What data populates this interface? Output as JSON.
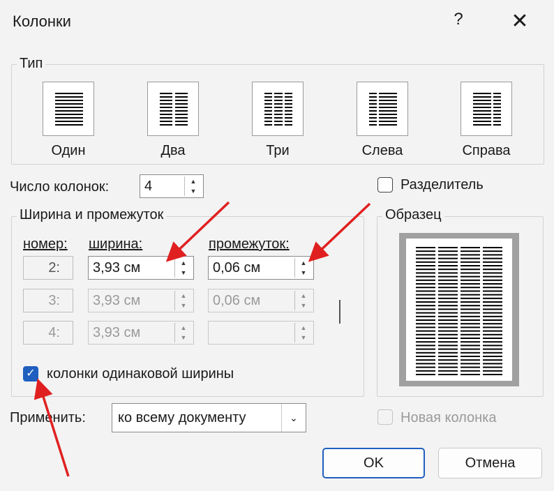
{
  "window": {
    "title": "Колонки",
    "help": "?",
    "close": "✕"
  },
  "type_group": {
    "legend": "Тип",
    "presets": [
      {
        "label": "Один"
      },
      {
        "label": "Два"
      },
      {
        "label": "Три"
      },
      {
        "label": "Слева"
      },
      {
        "label": "Справа"
      }
    ]
  },
  "column_count": {
    "label": "Число колонок:",
    "value": "4"
  },
  "separator": {
    "label": "Разделитель",
    "checked": false
  },
  "width_group": {
    "legend": "Ширина и промежуток",
    "headers": {
      "number": "номер:",
      "width": "ширина:",
      "spacing": "промежуток:"
    },
    "rows": [
      {
        "number": "2:",
        "width": "3,93 см",
        "spacing": "0,06 см",
        "enabled": true
      },
      {
        "number": "3:",
        "width": "3,93 см",
        "spacing": "0,06 см",
        "enabled": false
      },
      {
        "number": "4:",
        "width": "3,93 см",
        "spacing": "",
        "enabled": false
      }
    ],
    "equal_width": {
      "label": "колонки одинаковой ширины",
      "checked": true
    }
  },
  "preview": {
    "legend": "Образец"
  },
  "apply": {
    "label": "Применить:",
    "value": "ко всему документу"
  },
  "new_column": {
    "label": "Новая колонка",
    "checked": false
  },
  "buttons": {
    "ok": "OK",
    "cancel": "Отмена"
  },
  "colors": {
    "accent": "#1f5fbf",
    "annotation_arrow": "#e02020"
  }
}
